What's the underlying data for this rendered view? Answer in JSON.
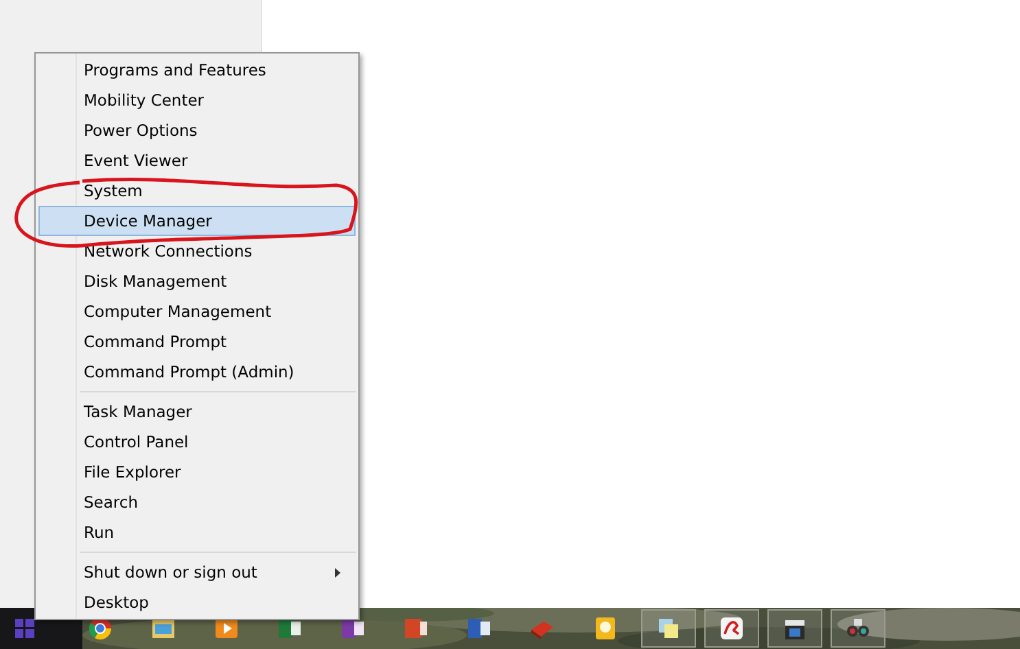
{
  "menu": {
    "groups": [
      {
        "items": [
          {
            "label": "Programs and Features",
            "selected": false,
            "has_submenu": false
          },
          {
            "label": "Mobility Center",
            "selected": false,
            "has_submenu": false
          },
          {
            "label": "Power Options",
            "selected": false,
            "has_submenu": false
          },
          {
            "label": "Event Viewer",
            "selected": false,
            "has_submenu": false
          },
          {
            "label": "System",
            "selected": false,
            "has_submenu": false
          },
          {
            "label": "Device Manager",
            "selected": true,
            "has_submenu": false
          },
          {
            "label": "Network Connections",
            "selected": false,
            "has_submenu": false
          },
          {
            "label": "Disk Management",
            "selected": false,
            "has_submenu": false
          },
          {
            "label": "Computer Management",
            "selected": false,
            "has_submenu": false
          },
          {
            "label": "Command Prompt",
            "selected": false,
            "has_submenu": false
          },
          {
            "label": "Command Prompt (Admin)",
            "selected": false,
            "has_submenu": false
          }
        ]
      },
      {
        "items": [
          {
            "label": "Task Manager",
            "selected": false,
            "has_submenu": false
          },
          {
            "label": "Control Panel",
            "selected": false,
            "has_submenu": false
          },
          {
            "label": "File Explorer",
            "selected": false,
            "has_submenu": false
          },
          {
            "label": "Search",
            "selected": false,
            "has_submenu": false
          },
          {
            "label": "Run",
            "selected": false,
            "has_submenu": false
          }
        ]
      },
      {
        "items": [
          {
            "label": "Shut down or sign out",
            "selected": false,
            "has_submenu": true
          },
          {
            "label": "Desktop",
            "selected": false,
            "has_submenu": false
          }
        ]
      }
    ]
  },
  "taskbar": {
    "apps": [
      {
        "kind": "browser",
        "running": false
      },
      {
        "kind": "folder",
        "running": false
      },
      {
        "kind": "player",
        "running": false
      },
      {
        "kind": "sheet",
        "running": false
      },
      {
        "kind": "notebook",
        "running": false
      },
      {
        "kind": "slides",
        "running": false
      },
      {
        "kind": "document",
        "running": false
      },
      {
        "kind": "book",
        "running": false
      },
      {
        "kind": "bulb",
        "running": false
      },
      {
        "kind": "notes",
        "running": true
      },
      {
        "kind": "scribble",
        "running": true
      },
      {
        "kind": "clapper",
        "running": true
      },
      {
        "kind": "glasses",
        "running": true
      }
    ]
  }
}
